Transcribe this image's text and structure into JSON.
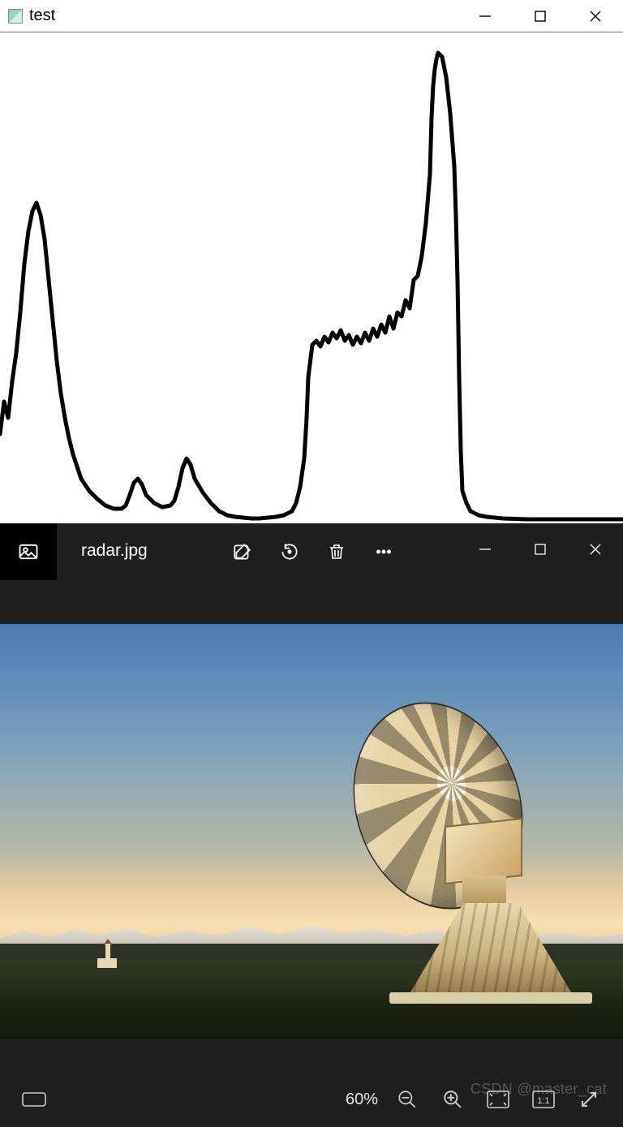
{
  "test_window": {
    "title": "test"
  },
  "photos_window": {
    "filename": "radar.jpg",
    "zoom_label": "60%"
  },
  "watermark": "CSDN @master_cat",
  "chart_data": {
    "type": "line",
    "title": "",
    "xlabel": "",
    "ylabel": "",
    "xlim": [
      0,
      768
    ],
    "ylim": [
      0,
      600
    ],
    "x": [
      0,
      5,
      10,
      15,
      20,
      25,
      30,
      35,
      40,
      45,
      50,
      55,
      60,
      65,
      70,
      75,
      80,
      85,
      90,
      95,
      100,
      110,
      120,
      130,
      140,
      150,
      155,
      160,
      165,
      170,
      175,
      180,
      190,
      200,
      210,
      215,
      220,
      225,
      230,
      235,
      240,
      250,
      260,
      270,
      280,
      290,
      300,
      310,
      320,
      330,
      340,
      350,
      360,
      365,
      370,
      375,
      378,
      380,
      385,
      390,
      395,
      400,
      405,
      410,
      415,
      420,
      425,
      430,
      435,
      440,
      445,
      450,
      455,
      460,
      465,
      470,
      475,
      480,
      485,
      490,
      495,
      500,
      505,
      510,
      515,
      520,
      525,
      530,
      532,
      534,
      536,
      538,
      540,
      545,
      550,
      555,
      560,
      562,
      564,
      566,
      568,
      570,
      575,
      580,
      590,
      600,
      620,
      650,
      700,
      768
    ],
    "values": [
      110,
      150,
      130,
      175,
      210,
      260,
      320,
      360,
      385,
      395,
      380,
      350,
      300,
      250,
      200,
      160,
      130,
      105,
      85,
      70,
      55,
      40,
      30,
      22,
      18,
      18,
      22,
      35,
      50,
      55,
      48,
      35,
      25,
      20,
      22,
      28,
      45,
      68,
      80,
      72,
      55,
      38,
      25,
      15,
      10,
      8,
      7,
      6,
      6,
      7,
      8,
      10,
      15,
      25,
      45,
      80,
      130,
      180,
      220,
      225,
      218,
      230,
      223,
      235,
      228,
      238,
      225,
      232,
      220,
      230,
      222,
      235,
      225,
      240,
      230,
      245,
      235,
      255,
      240,
      260,
      255,
      275,
      265,
      300,
      305,
      330,
      370,
      430,
      500,
      540,
      560,
      572,
      580,
      575,
      550,
      505,
      440,
      380,
      300,
      180,
      90,
      40,
      25,
      15,
      10,
      8,
      6,
      5,
      5,
      5
    ]
  }
}
